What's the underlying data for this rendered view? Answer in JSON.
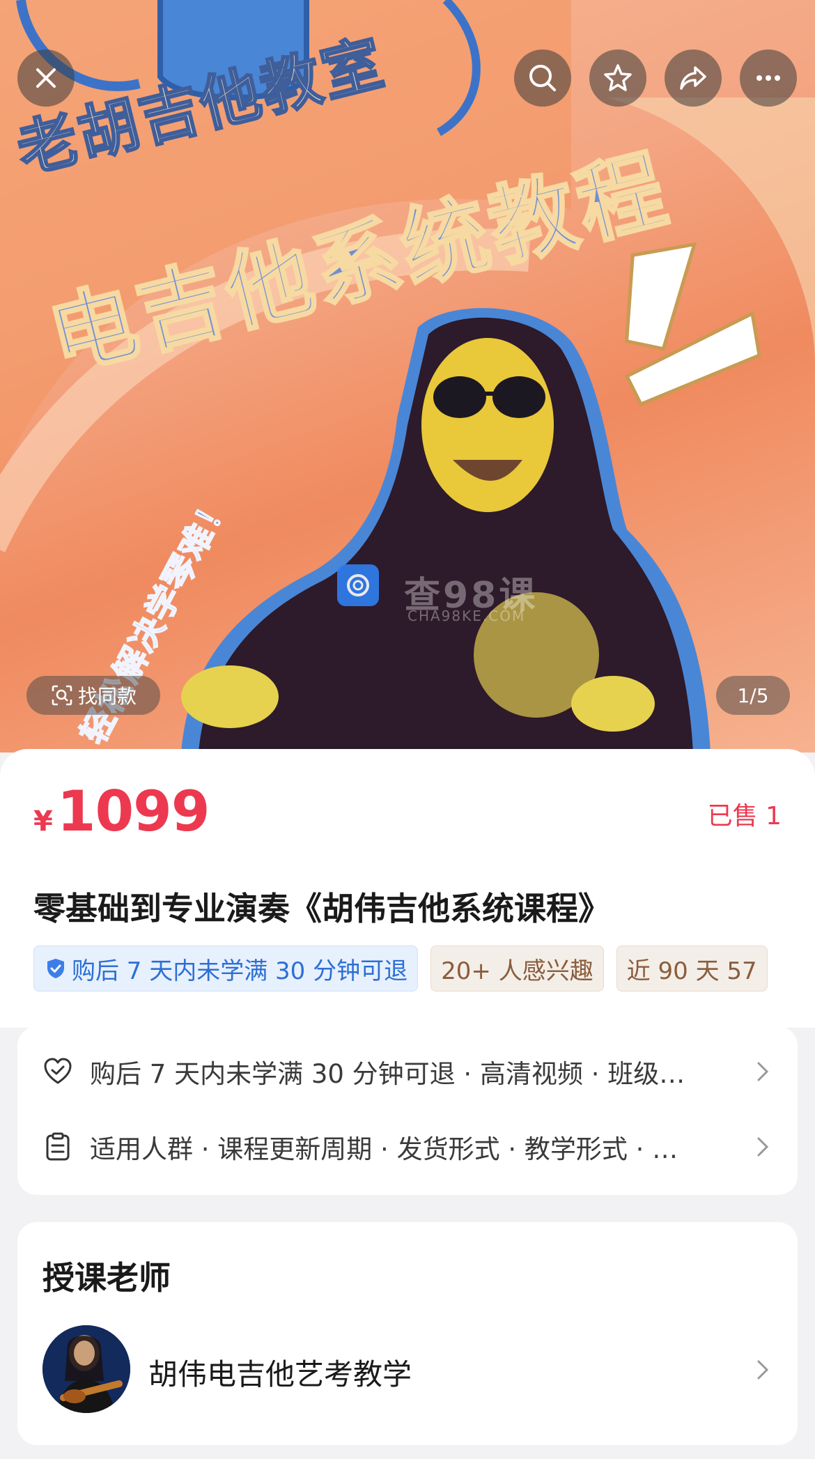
{
  "hero": {
    "title_line1": "老胡吉他教室",
    "title_line2": "电吉他系统教程",
    "side_text": "轻松解决学琴难！",
    "watermark_text": "查98课",
    "watermark_sub": "CHA98KE.COM",
    "find_similar_label": "找同款",
    "page_indicator": "1/5"
  },
  "topbar": {
    "icons": [
      "close-icon",
      "search-icon",
      "star-icon",
      "share-icon",
      "more-icon"
    ]
  },
  "price": {
    "currency": "¥",
    "amount": "1099",
    "sold": "已售 1"
  },
  "product": {
    "title": "零基础到专业演奏《胡伟吉他系统课程》"
  },
  "tags": [
    {
      "label": "购后 7 天内未学满 30 分钟可退",
      "style": "blue"
    },
    {
      "label": "20+ 人感兴趣",
      "style": "brown"
    },
    {
      "label": "近 90 天 57",
      "style": "brown"
    }
  ],
  "service": {
    "row1": "购后 7 天内未学满 30 分钟可退 · 高清视频 · 班级…",
    "row2": "适用人群 · 课程更新周期 · 发货形式 · 教学形式 · …"
  },
  "teacher_section": {
    "title": "授课老师",
    "name": "胡伟电吉他艺考教学"
  },
  "colors": {
    "accent_red": "#ec3950",
    "tag_blue": "#2c6fd6",
    "tag_brown": "#8a5d3c"
  }
}
